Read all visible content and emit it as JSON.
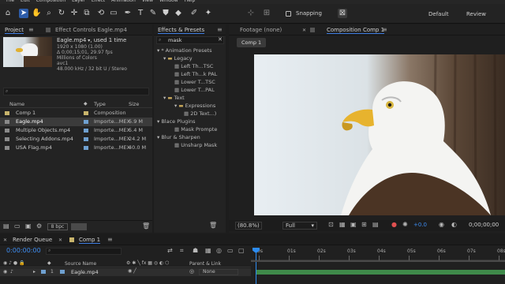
{
  "menu": [
    "File",
    "Edit",
    "Composition",
    "Layer",
    "Effect",
    "Animation",
    "View",
    "Window",
    "Help"
  ],
  "toolbar": {
    "tools": [
      "home-icon",
      "select-icon",
      "hand-icon",
      "zoom-icon",
      "rotate-icon",
      "camera-icon",
      "pan-behind-icon",
      "rectangle-icon",
      "pen-icon",
      "type-icon",
      "brush-icon",
      "clone-stamp-icon",
      "eraser-icon",
      "roto-brush-icon",
      "puppet-pin-icon"
    ],
    "snapping_label": "Snapping",
    "workspaces": [
      "Default",
      "Review"
    ]
  },
  "project": {
    "tab_label": "Project",
    "effect_controls_tab": "Effect Controls Eagle.mp4",
    "selected_name": "Eagle.mp4",
    "used_label": ", used 1 time",
    "info_lines": [
      "1920 x 1080 (1.00)",
      "Δ 0;00;15;01, 29.97 fps",
      "Millions of Colors",
      "avc1",
      "48.000 kHz / 32 bit U / Stereo"
    ],
    "search_placeholder": "",
    "columns": {
      "name": "Name",
      "type": "Type",
      "size": "Size"
    },
    "items": [
      {
        "name": "Comp 1",
        "type": "Composition",
        "size": "",
        "color": "#c8b46c",
        "selected": false
      },
      {
        "name": "Eagle.mp4",
        "type": "Importe...MEX",
        "size": "5.9 M",
        "color": "#6fa0d0",
        "selected": true
      },
      {
        "name": "Multiple Objects.mp4",
        "type": "Importe...MEX",
        "size": "5.4 M",
        "color": "#6fa0d0",
        "selected": false
      },
      {
        "name": "Selecting Addons.mp4",
        "type": "Importe...MEX",
        "size": "24.2 M",
        "color": "#6fa0d0",
        "selected": false
      },
      {
        "name": "USA Flag.mp4",
        "type": "Importe...MEX",
        "size": "40.0 M",
        "color": "#6fa0d0",
        "selected": false
      }
    ],
    "bpc": "8 bpc"
  },
  "effects": {
    "tab_label": "Effects & Presets",
    "search_value": "mask",
    "tree": [
      {
        "label": "* Animation Presets",
        "level": 0,
        "kind": "group"
      },
      {
        "label": "Legacy",
        "level": 1,
        "kind": "folder"
      },
      {
        "label": "Left Th...TSC",
        "level": 2,
        "kind": "preset"
      },
      {
        "label": "Left Th...k PAL",
        "level": 2,
        "kind": "preset"
      },
      {
        "label": "Lower T...TSC",
        "level": 2,
        "kind": "preset"
      },
      {
        "label": "Lower T...PAL",
        "level": 2,
        "kind": "preset"
      },
      {
        "label": "Text",
        "level": 1,
        "kind": "folder"
      },
      {
        "label": "Expressions",
        "level": 2,
        "kind": "folder"
      },
      {
        "label": "2D Text...)",
        "level": 3,
        "kind": "preset"
      },
      {
        "label": "Blace Plugins",
        "level": 0,
        "kind": "group"
      },
      {
        "label": "Mask Prompte",
        "level": 2,
        "kind": "effect"
      },
      {
        "label": "Blur & Sharpen",
        "level": 0,
        "kind": "group"
      },
      {
        "label": "Unsharp Mask",
        "level": 2,
        "kind": "effect"
      }
    ]
  },
  "viewer": {
    "footage_tab": "Footage (none)",
    "comp_tab": "Composition Comp 1",
    "comp_chip": "Comp 1",
    "zoom": "(80.8%)",
    "resolution": "Full",
    "exposure": "+0.0",
    "timecode": "0;00;00;00"
  },
  "timeline": {
    "render_queue_tab": "Render Queue",
    "comp_tab": "Comp 1",
    "timecode": "0:00:00:00",
    "search_placeholder": "",
    "columns": {
      "source": "Source Name",
      "parent": "Parent & Link"
    },
    "layers": [
      {
        "index": "1",
        "name": "Eagle.mp4",
        "parent": "None"
      }
    ],
    "ticks": [
      "0s",
      "01s",
      "02s",
      "03s",
      "04s",
      "05s",
      "06s",
      "07s",
      "08s"
    ]
  },
  "colors": {
    "accent": "#2d8cf0",
    "selected_tab": "#3c7be0",
    "layer_bar": "#3f8a4a"
  }
}
